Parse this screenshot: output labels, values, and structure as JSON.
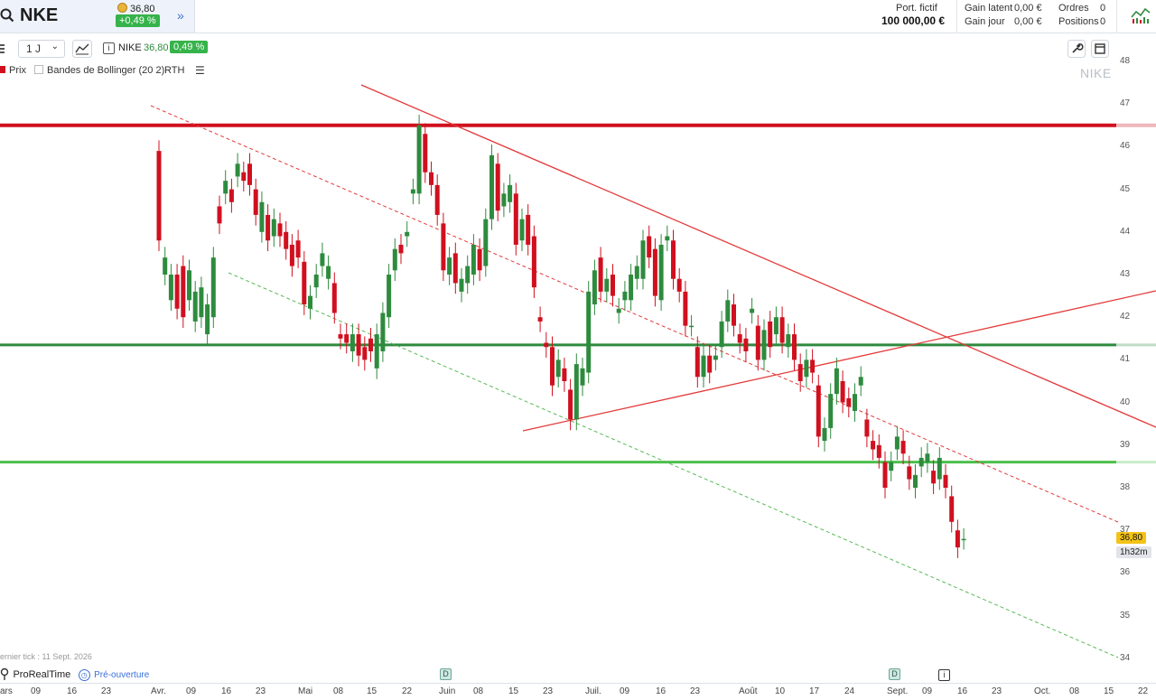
{
  "header": {
    "ticker": "NKE",
    "price": "36,80",
    "change": "+0,49 %",
    "portfolio_label": "Port. fictif",
    "portfolio_value": "100 000,00 €",
    "gain_latent_label": "Gain latent",
    "gain_latent_value": "0,00 €",
    "gain_jour_label": "Gain jour",
    "gain_jour_value": "0,00 €",
    "ordres_label": "Ordres",
    "ordres_value": "0",
    "positions_label": "Positions",
    "positions_value": "0"
  },
  "toolbar": {
    "interval": "1 J",
    "symbol": "NIKE",
    "price": "36,80",
    "change": "0,49 %"
  },
  "legend": {
    "prix": "Prix",
    "bollinger": "Bandes de Bollinger (20 2)",
    "rth": "RTH"
  },
  "chart": {
    "watermark": "NIKE",
    "price_tag": "36,80",
    "time_tag": "1h32m",
    "last_tick": "ernier tick : 11 Sept. 2026",
    "brand": "ProRealTime",
    "status": "Pré-ouverture",
    "event_d": "D",
    "event_i": "i"
  },
  "chart_data": {
    "type": "candlestick",
    "y_ticks": [
      "48",
      "47",
      "46",
      "45",
      "44",
      "43",
      "42",
      "41",
      "40",
      "39",
      "38",
      "37",
      "36",
      "35",
      "34"
    ],
    "x_ticks": [
      "ars",
      "09",
      "16",
      "23",
      "Avr.",
      "09",
      "16",
      "23",
      "Mai",
      "08",
      "15",
      "22",
      "Juin",
      "08",
      "15",
      "23",
      "Juil.",
      "09",
      "16",
      "23",
      "Août",
      "10",
      "17",
      "24",
      "Sept.",
      "09",
      "16",
      "23",
      "Oct.",
      "08",
      "15",
      "22"
    ],
    "ylim": [
      33.7,
      48.2
    ],
    "candles": [
      [
        45.9,
        43.8
      ],
      [
        43.0,
        43.4
      ],
      [
        42.4,
        43.0
      ],
      [
        43.0,
        42.2
      ],
      [
        43.2,
        42.0
      ],
      [
        42.4,
        43.1
      ],
      [
        41.9,
        42.6
      ],
      [
        42.0,
        42.7
      ],
      [
        41.6,
        42.3
      ],
      [
        42.0,
        43.4
      ],
      [
        44.6,
        44.2
      ],
      [
        44.9,
        45.2
      ],
      [
        45.0,
        44.7
      ],
      [
        45.3,
        45.6
      ],
      [
        45.4,
        45.2
      ],
      [
        45.6,
        45.1
      ],
      [
        45.0,
        44.4
      ],
      [
        44.0,
        44.7
      ],
      [
        44.4,
        43.8
      ],
      [
        43.9,
        44.3
      ],
      [
        44.2,
        43.9
      ],
      [
        44.0,
        43.6
      ],
      [
        43.7,
        43.2
      ],
      [
        43.8,
        43.4
      ],
      [
        43.3,
        42.3
      ],
      [
        42.2,
        42.5
      ],
      [
        42.7,
        43.0
      ],
      [
        43.2,
        43.5
      ],
      [
        42.9,
        43.2
      ],
      [
        42.8,
        42.1
      ],
      [
        41.6,
        41.5
      ],
      [
        41.6,
        41.4
      ],
      [
        41.2,
        41.6
      ],
      [
        41.6,
        41.1
      ],
      [
        41.3,
        41.0
      ],
      [
        41.5,
        41.2
      ],
      [
        40.8,
        41.6
      ],
      [
        41.2,
        42.1
      ],
      [
        42.0,
        43.0
      ],
      [
        43.1,
        43.6
      ],
      [
        43.7,
        43.5
      ],
      [
        43.9,
        44.0
      ],
      [
        44.9,
        45.0
      ],
      [
        44.9,
        46.5
      ],
      [
        46.3,
        45.4
      ],
      [
        45.4,
        45.1
      ],
      [
        45.1,
        44.4
      ],
      [
        44.2,
        43.1
      ],
      [
        43.0,
        43.4
      ],
      [
        43.5,
        42.8
      ],
      [
        42.6,
        42.9
      ],
      [
        42.8,
        43.2
      ],
      [
        43.0,
        43.7
      ],
      [
        43.6,
        43.1
      ],
      [
        43.2,
        44.3
      ],
      [
        44.3,
        45.8
      ],
      [
        45.6,
        44.5
      ],
      [
        44.6,
        44.9
      ],
      [
        44.7,
        45.1
      ],
      [
        44.9,
        43.7
      ],
      [
        43.8,
        44.3
      ],
      [
        44.4,
        43.7
      ],
      [
        43.9,
        42.7
      ],
      [
        42.0,
        41.9
      ],
      [
        41.4,
        41.3
      ],
      [
        41.3,
        40.4
      ],
      [
        40.6,
        41.0
      ],
      [
        40.8,
        40.5
      ],
      [
        40.3,
        39.6
      ],
      [
        39.6,
        40.9
      ],
      [
        40.4,
        40.8
      ],
      [
        40.7,
        42.6
      ],
      [
        42.3,
        43.1
      ],
      [
        43.4,
        42.6
      ],
      [
        42.6,
        42.9
      ],
      [
        43.0,
        42.5
      ],
      [
        42.1,
        42.2
      ],
      [
        42.4,
        42.6
      ],
      [
        42.4,
        43.0
      ],
      [
        42.9,
        43.2
      ],
      [
        42.9,
        43.8
      ],
      [
        43.9,
        43.4
      ],
      [
        43.6,
        42.5
      ],
      [
        42.4,
        43.7
      ],
      [
        43.8,
        43.9
      ],
      [
        43.8,
        42.9
      ],
      [
        42.9,
        42.6
      ],
      [
        42.6,
        41.8
      ],
      [
        41.8,
        41.8
      ],
      [
        41.3,
        40.6
      ],
      [
        40.6,
        41.1
      ],
      [
        41.1,
        40.7
      ],
      [
        41.0,
        41.1
      ],
      [
        41.3,
        41.9
      ],
      [
        41.9,
        42.4
      ],
      [
        42.3,
        41.8
      ],
      [
        41.6,
        41.4
      ],
      [
        41.5,
        41.2
      ],
      [
        42.1,
        42.2
      ],
      [
        41.8,
        41.0
      ],
      [
        41.0,
        41.7
      ],
      [
        41.9,
        41.3
      ],
      [
        41.6,
        42.0
      ],
      [
        42.0,
        41.4
      ],
      [
        41.3,
        41.6
      ],
      [
        41.6,
        41.0
      ],
      [
        40.9,
        40.5
      ],
      [
        40.6,
        41.0
      ],
      [
        41.0,
        40.7
      ],
      [
        40.4,
        39.2
      ],
      [
        39.1,
        39.4
      ],
      [
        39.4,
        40.2
      ],
      [
        40.2,
        40.8
      ],
      [
        40.5,
        40.0
      ],
      [
        40.1,
        39.9
      ],
      [
        39.8,
        40.2
      ],
      [
        40.4,
        40.6
      ],
      [
        39.6,
        39.2
      ],
      [
        39.1,
        38.9
      ],
      [
        39.0,
        38.7
      ],
      [
        38.6,
        38.0
      ],
      [
        38.4,
        38.6
      ],
      [
        38.9,
        39.2
      ],
      [
        39.1,
        38.8
      ],
      [
        38.5,
        38.2
      ],
      [
        38.0,
        38.3
      ],
      [
        38.5,
        38.7
      ],
      [
        38.6,
        38.8
      ],
      [
        38.4,
        38.1
      ],
      [
        38.2,
        38.7
      ],
      [
        38.3,
        38.0
      ],
      [
        37.8,
        37.2
      ],
      [
        37.0,
        36.6
      ],
      [
        36.8,
        36.8
      ]
    ]
  },
  "colors": {
    "up": "#2e8b3e",
    "down": "#d0101f",
    "resistance": "#d0101f",
    "support1": "#2e8b3e",
    "support2": "#4cbf4c",
    "trend": "#e33a3a",
    "tag": "#f3c316"
  }
}
